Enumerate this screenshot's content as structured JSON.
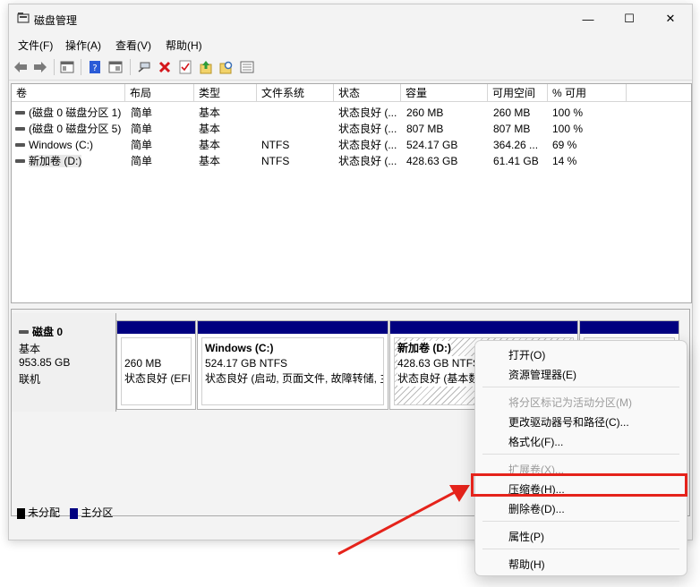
{
  "window": {
    "title": "磁盘管理",
    "controls": {
      "minimize": "—",
      "maximize": "☐",
      "close": "✕"
    }
  },
  "menu": [
    "文件(F)",
    "操作(A)",
    "查看(V)",
    "帮助(H)"
  ],
  "toolbar_icons": [
    "back-icon",
    "forward-icon",
    "console-tree-icon",
    "help-icon",
    "properties-icon",
    "connect-icon",
    "delete-icon",
    "check-icon",
    "up-icon",
    "find-icon",
    "list-icon"
  ],
  "columns": [
    "卷",
    "布局",
    "类型",
    "文件系统",
    "状态",
    "容量",
    "可用空间",
    "% 可用"
  ],
  "volumes": [
    [
      "(磁盘 0 磁盘分区 1)",
      "简单",
      "基本",
      "",
      "状态良好 (...",
      "260 MB",
      "260 MB",
      "100 %"
    ],
    [
      "(磁盘 0 磁盘分区 5)",
      "简单",
      "基本",
      "",
      "状态良好 (...",
      "807 MB",
      "807 MB",
      "100 %"
    ],
    [
      "Windows (C:)",
      "简单",
      "基本",
      "NTFS",
      "状态良好 (...",
      "524.17 GB",
      "364.26 ...",
      "69 %"
    ],
    [
      "新加卷 (D:)",
      "简单",
      "基本",
      "NTFS",
      "状态良好 (...",
      "428.63 GB",
      "61.41 GB",
      "14 %"
    ]
  ],
  "disk": {
    "name": "磁盘 0",
    "type": "基本",
    "size": "953.85 GB",
    "status": "联机"
  },
  "partitions": [
    {
      "title": "",
      "line1": "260 MB",
      "line2": "状态良好 (EFI"
    },
    {
      "title": "Windows (C:)",
      "line1": "524.17 GB NTFS",
      "line2": "状态良好 (启动, 页面文件, 故障转储, 主"
    },
    {
      "title": "新加卷 (D:)",
      "line1": "428.63 GB NTFS",
      "line2": "状态良好 (基本数"
    },
    {
      "title": "",
      "line1": "",
      "line2": ""
    }
  ],
  "legend": [
    {
      "label": "未分配",
      "color": "#000000"
    },
    {
      "label": "主分区",
      "color": "#000080"
    }
  ],
  "context_menu": {
    "open": "打开(O)",
    "explorer": "资源管理器(E)",
    "mark_active": "将分区标记为活动分区(M)",
    "change_letter": "更改驱动器号和路径(C)...",
    "format": "格式化(F)...",
    "extend": "扩展卷(X)...",
    "shrink": "压缩卷(H)...",
    "delete": "删除卷(D)...",
    "properties": "属性(P)",
    "help": "帮助(H)"
  },
  "colors": {
    "primary_partition": "#000080",
    "highlight": "#e5231b"
  }
}
